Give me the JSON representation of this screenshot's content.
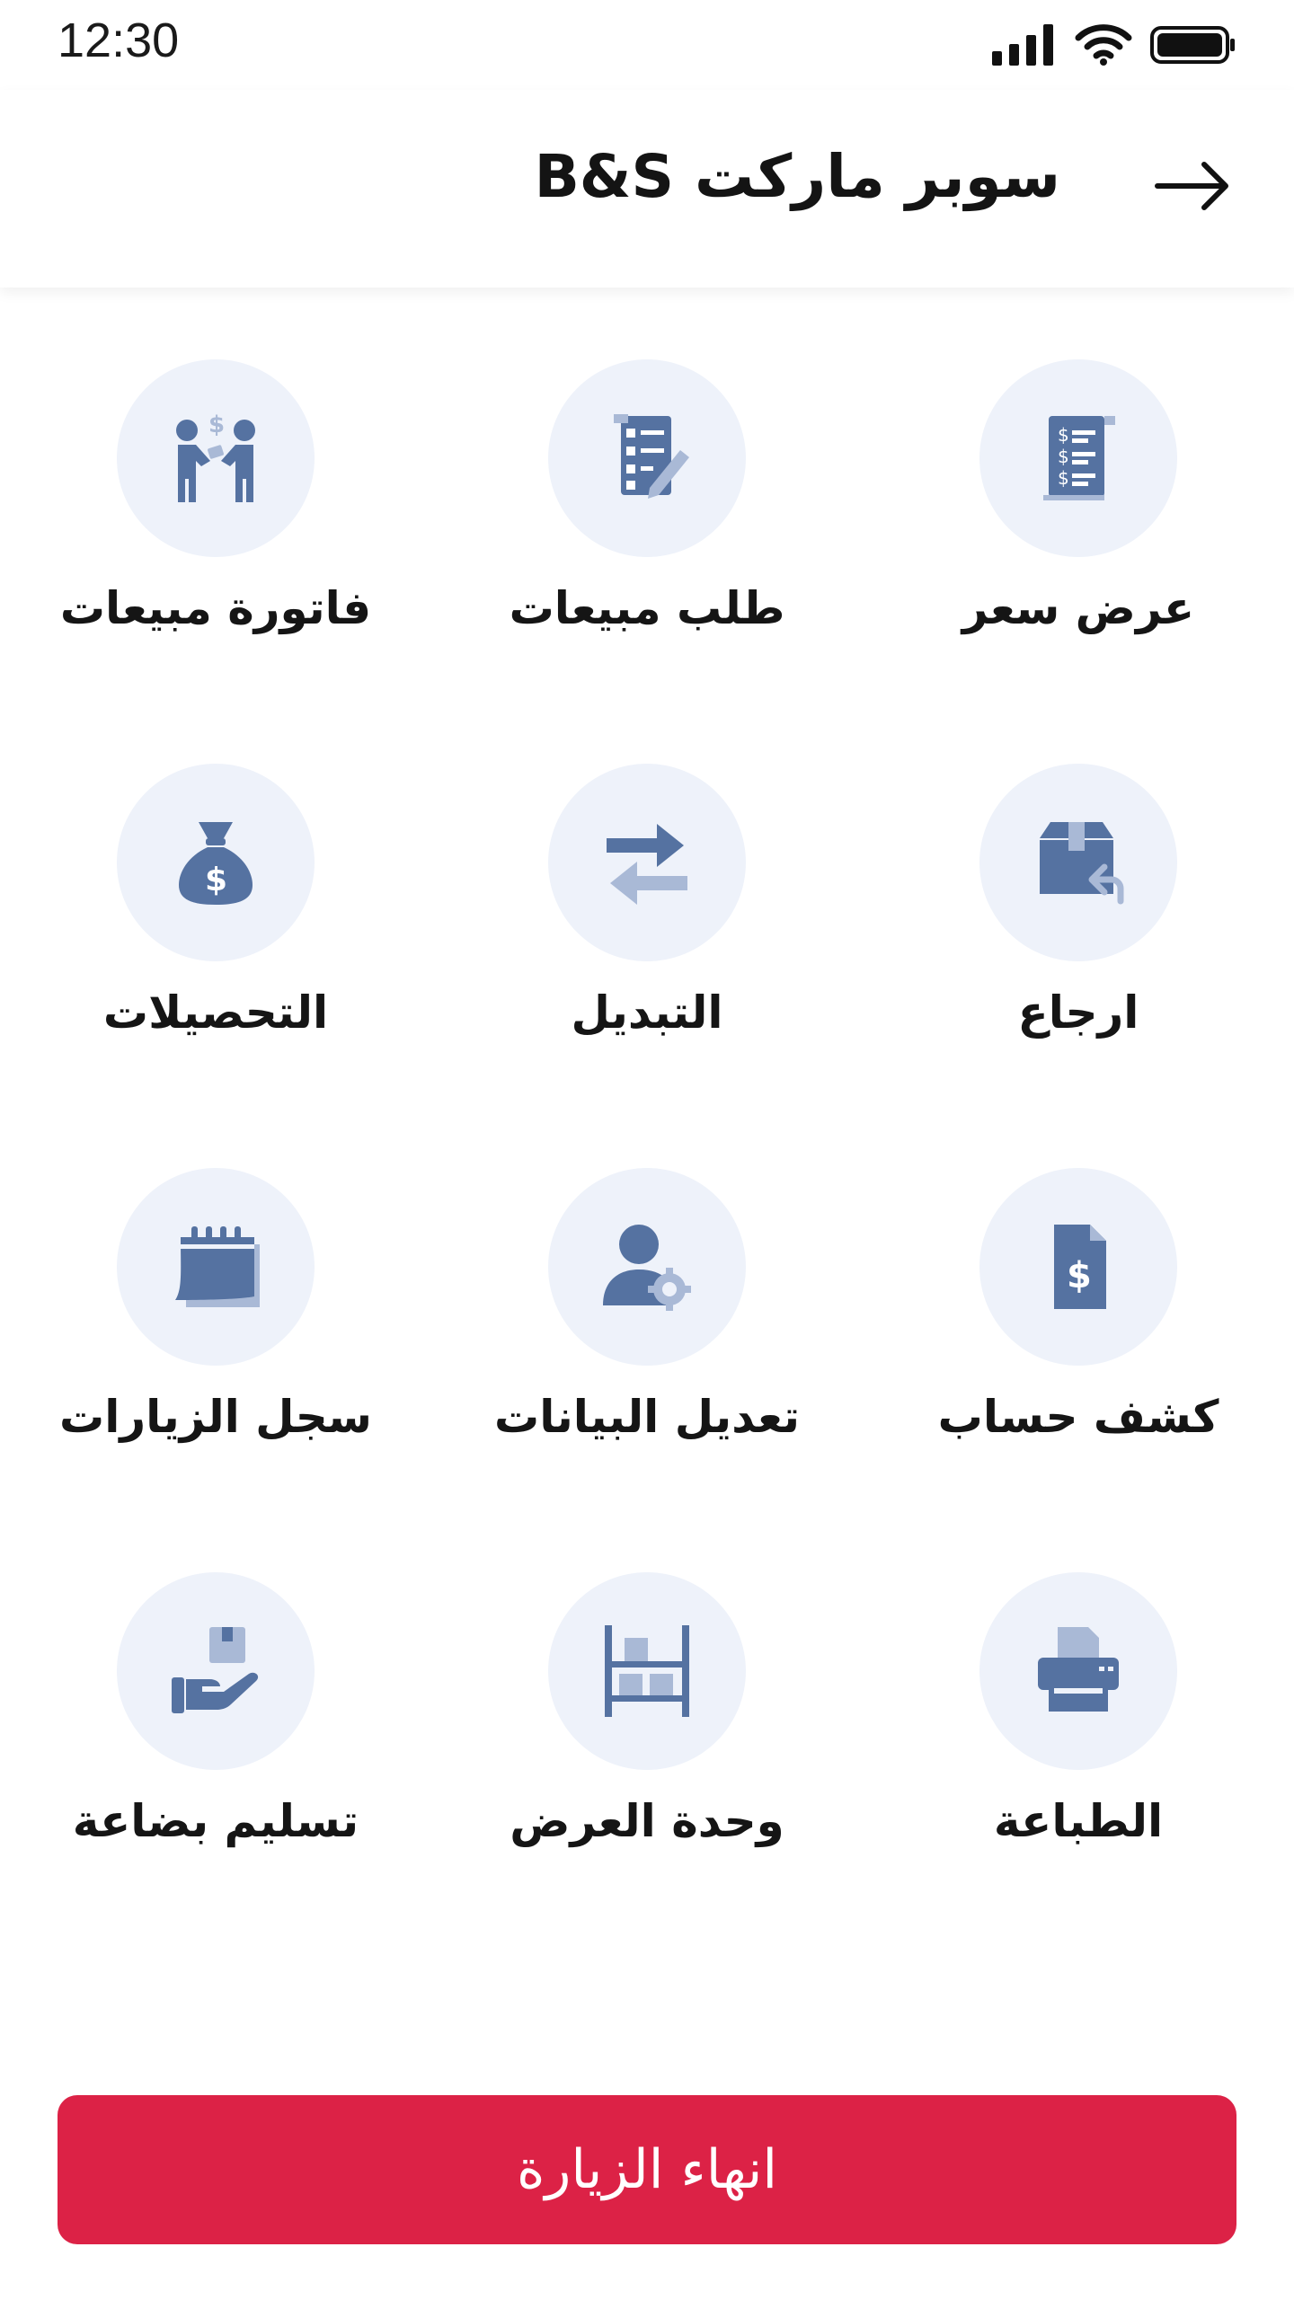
{
  "status_bar": {
    "time": "12:30"
  },
  "header": {
    "title": "سوبر ماركت B&S"
  },
  "menu": [
    {
      "label": "عرض سعر",
      "icon": "price-quote-icon"
    },
    {
      "label": "طلب مبيعات",
      "icon": "sales-order-icon"
    },
    {
      "label": "فاتورة مبيعات",
      "icon": "sales-invoice-icon"
    },
    {
      "label": "ارجاع",
      "icon": "return-box-icon"
    },
    {
      "label": "التبديل",
      "icon": "exchange-arrows-icon"
    },
    {
      "label": "التحصيلات",
      "icon": "money-bag-icon"
    },
    {
      "label": "كشف حساب",
      "icon": "account-statement-icon"
    },
    {
      "label": "تعديل البيانات",
      "icon": "edit-profile-icon"
    },
    {
      "label": "سجل الزيارات",
      "icon": "calendar-icon"
    },
    {
      "label": "الطباعة",
      "icon": "printer-icon"
    },
    {
      "label": "وحدة العرض",
      "icon": "display-shelf-icon"
    },
    {
      "label": "تسليم بضاعة",
      "icon": "goods-delivery-icon"
    }
  ],
  "footer": {
    "end_visit_label": "انهاء الزيارة"
  },
  "colors": {
    "primary_icon": "#5572a1",
    "secondary_icon": "#a9b9d6",
    "circle_bg": "#eef2fa",
    "end_button": "#dc2246"
  }
}
